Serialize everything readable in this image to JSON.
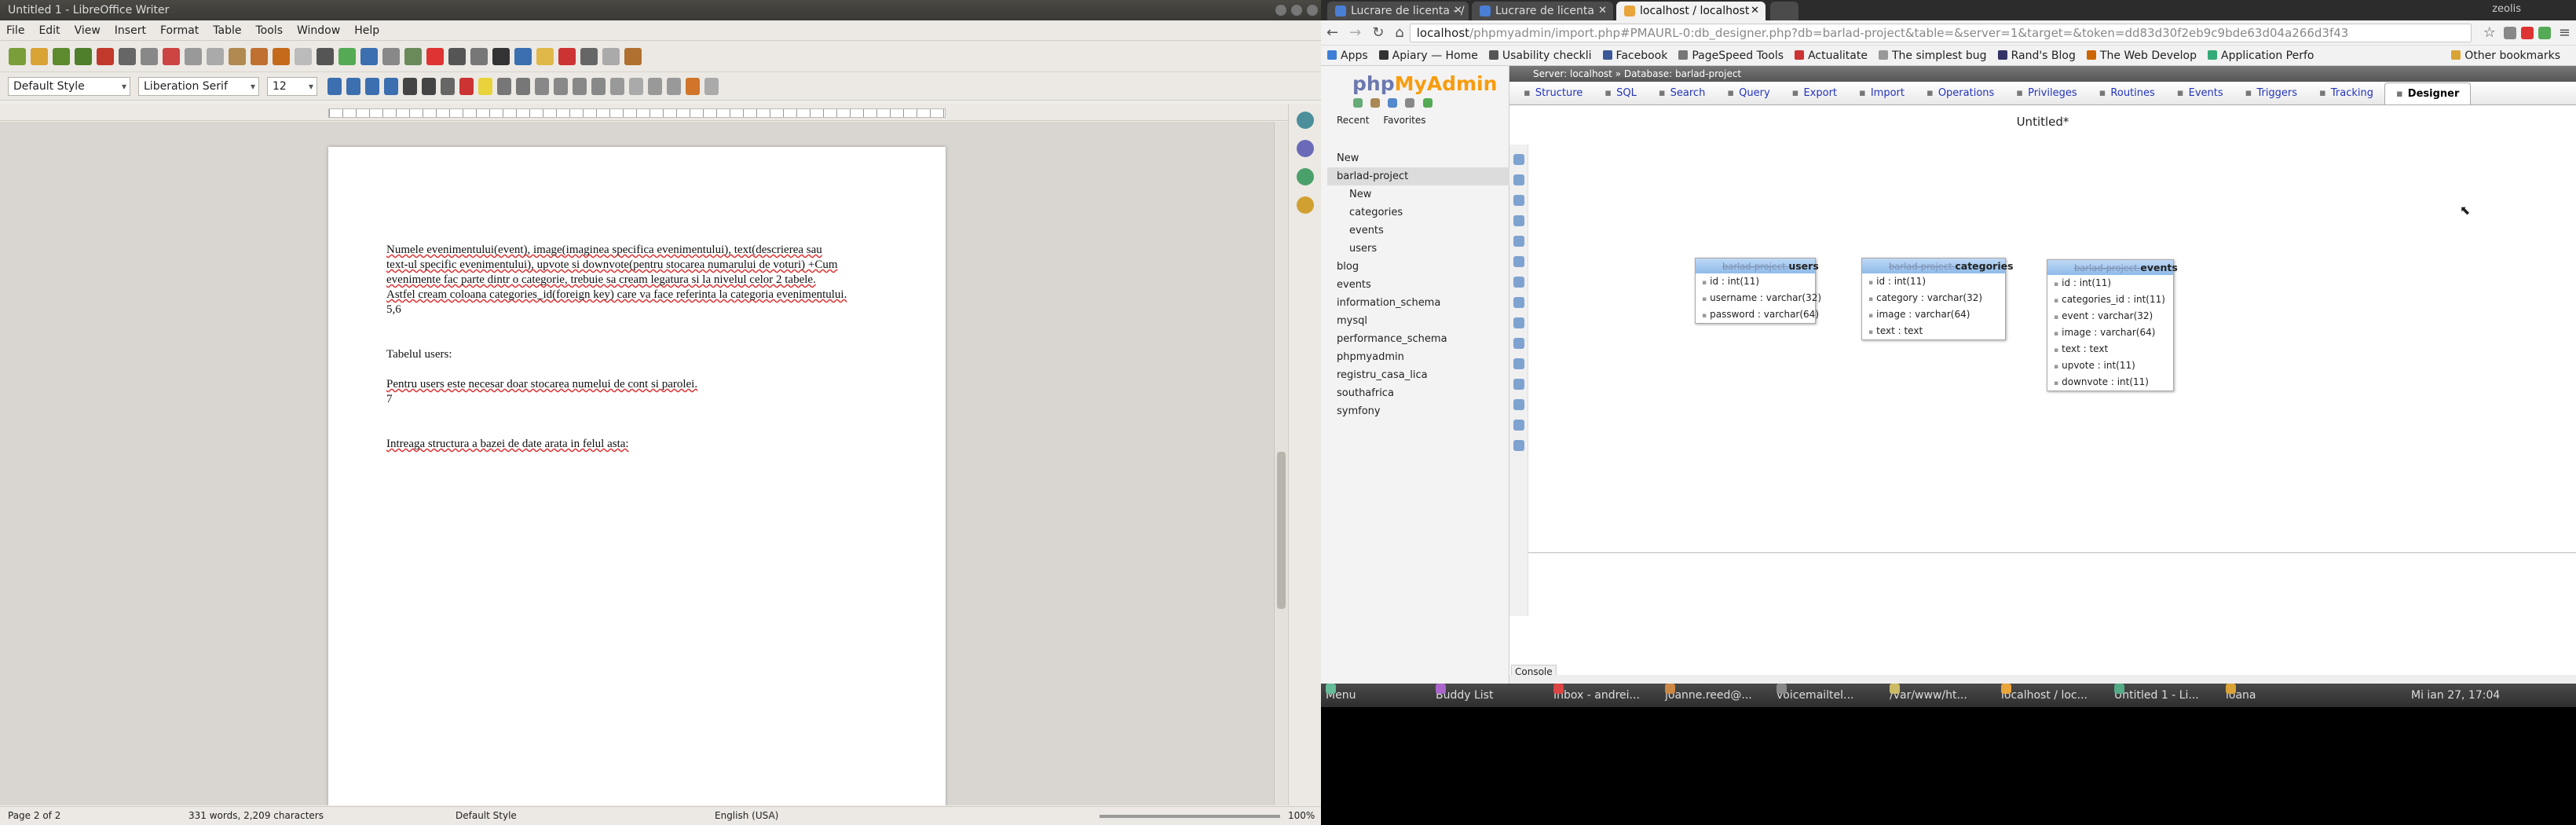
{
  "writer": {
    "title": "Untitled 1 - LibreOffice Writer",
    "menu": [
      "File",
      "Edit",
      "View",
      "Insert",
      "Format",
      "Table",
      "Tools",
      "Window",
      "Help"
    ],
    "style": "Default Style",
    "font": "Liberation Serif",
    "size": "12",
    "para1_line1": "Numele evenimentului(event), image(imaginea specifica evenimentului), text(descrierea sau",
    "para1_line2": "text-ul specific evenimentului), upvote si downvote(pentru stocarea numarului de voturi) +Cum",
    "para1_line3": "evenimente fac parte dintr o categorie, trebuie sa cream legatura si la nivelul celor 2 tabele.",
    "para1_line4": "Astfel cream coloana categories_id(foreign key) care va face referinta la categoria evenimentului.",
    "para1_line5": "5,6",
    "para2": "Tabelul users:",
    "para3": "Pentru users este necesar doar stocarea numelui de cont si parolei.",
    "para3b": "7",
    "para4": "Intreaga structura a bazei de date arata in felul asta:",
    "status_page": "Page 2 of 2",
    "status_words": "331 words, 2,209 characters",
    "status_style": "Default Style",
    "status_lang": "English (USA)",
    "status_zoom": "100%"
  },
  "chrome": {
    "tabs": [
      "Lucrare de licenta - /",
      "Lucrare de licenta",
      "localhost / localhost"
    ],
    "user": "zeolis",
    "url_host": "localhost",
    "url_path": "/phpmyadmin/import.php#PMAURL-0:db_designer.php?db=barlad-project&table=&server=1&target=&token=dd83d30f2eb9c9bde63d04a266d3f43",
    "bookmarks": [
      "Apps",
      "Apiary — Home",
      "Usability checkli",
      "Facebook",
      "PageSpeed Tools",
      "Actualitate",
      "The simplest bug",
      "Rand's Blog",
      "The Web Develop",
      "Application Perfo"
    ],
    "other_bookmarks": "Other bookmarks"
  },
  "pma": {
    "logo_a": "php",
    "logo_b": "MyAdmin",
    "recent": "Recent",
    "favorites": "Favorites",
    "tree": [
      {
        "label": "New",
        "indent": 1
      },
      {
        "label": "barlad-project",
        "indent": 1,
        "sel": true
      },
      {
        "label": "New",
        "indent": 2
      },
      {
        "label": "categories",
        "indent": 2
      },
      {
        "label": "events",
        "indent": 2
      },
      {
        "label": "users",
        "indent": 2
      },
      {
        "label": "blog",
        "indent": 1
      },
      {
        "label": "events",
        "indent": 1
      },
      {
        "label": "information_schema",
        "indent": 1
      },
      {
        "label": "mysql",
        "indent": 1
      },
      {
        "label": "performance_schema",
        "indent": 1
      },
      {
        "label": "phpmyadmin",
        "indent": 1
      },
      {
        "label": "registru_casa_lica",
        "indent": 1
      },
      {
        "label": "southafrica",
        "indent": 1
      },
      {
        "label": "symfony",
        "indent": 1
      }
    ],
    "breadcrumb": "Server: localhost » Database: barlad-project",
    "tabs": [
      "Structure",
      "SQL",
      "Search",
      "Query",
      "Export",
      "Import",
      "Operations",
      "Privileges",
      "Routines",
      "Events",
      "Triggers",
      "Tracking",
      "Designer"
    ],
    "designer_title": "Untitled*",
    "console": "Console",
    "tables": [
      {
        "db": "barlad-project",
        "name": "users",
        "cols": [
          "id : int(11)",
          "username : varchar(32)",
          "password : varchar(64)"
        ]
      },
      {
        "db": "barlad-project",
        "name": "categories",
        "cols": [
          "id : int(11)",
          "category : varchar(32)",
          "image : varchar(64)",
          "text : text"
        ]
      },
      {
        "db": "barlad-project",
        "name": "events",
        "cols": [
          "id : int(11)",
          "categories_id : int(11)",
          "event : varchar(32)",
          "image : varchar(64)",
          "text : text",
          "upvote : int(11)",
          "downvote : int(11)"
        ]
      }
    ]
  },
  "taskbar": {
    "menu": "Menu",
    "items": [
      "Buddy List",
      "Inbox - andrei...",
      "joanne.reed@...",
      "voicemailtel...",
      "/var/www/ht...",
      "localhost / loc...",
      "Untitled 1 - Li...",
      "ioana"
    ],
    "clock": "Mi ian 27, 17:04"
  }
}
